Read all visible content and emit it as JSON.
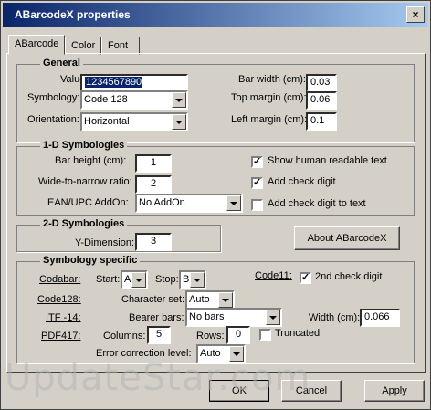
{
  "window": {
    "title": "ABarcodeX properties",
    "close_glyph": "×"
  },
  "tabs": [
    {
      "label": "ABarcode"
    },
    {
      "label": "Color"
    },
    {
      "label": "Font"
    }
  ],
  "general": {
    "title": "General",
    "value_label": "Value:",
    "value": "1234567890",
    "symbology_label": "Symbology:",
    "symbology_value": "Code 128",
    "orientation_label": "Orientation:",
    "orientation_value": "Horizontal",
    "bar_width_label": "Bar width (cm):",
    "bar_width_value": "0.03",
    "top_margin_label": "Top margin (cm):",
    "top_margin_value": "0.06",
    "left_margin_label": "Left margin (cm):",
    "left_margin_value": "0.1"
  },
  "one_d": {
    "title": "1-D Symbologies",
    "bar_height_label": "Bar height (cm):",
    "bar_height_value": "1",
    "wide_narrow_label": "Wide-to-narrow ratio:",
    "wide_narrow_value": "2",
    "ean_label": "EAN/UPC AddOn:",
    "ean_value": "No AddOn",
    "show_human_label": "Show human readable text",
    "add_check_label": "Add check digit",
    "add_check_text_label": "Add check digit to text",
    "check_mark": "✓"
  },
  "two_d": {
    "title": "2-D Symbologies",
    "y_dimension_label": "Y-Dimension:",
    "y_dimension_value": "3"
  },
  "about_button": "About ABarcodeX",
  "specific": {
    "title": "Symbology specific",
    "codabar_label": "Codabar:",
    "start_label": "Start:",
    "start_value": "A",
    "stop_label": "Stop:",
    "stop_value": "B",
    "code11_label": "Code11:",
    "second_check_label": "2nd check digit",
    "code128_label": "Code128:",
    "charset_label": "Character set:",
    "charset_value": "Auto",
    "itf_label": "ITF -14:",
    "bearer_label": "Bearer bars:",
    "bearer_value": "No bars",
    "width_label": "Width (cm):",
    "width_value": "0.066",
    "pdf_label": "PDF417:",
    "columns_label": "Columns:",
    "columns_value": "5",
    "rows_label": "Rows:",
    "rows_value": "0",
    "truncated_label": "Truncated",
    "ecl_label": "Error correction level:",
    "ecl_value": "Auto"
  },
  "buttons": {
    "ok": "OK",
    "cancel": "Cancel",
    "apply": "Apply"
  },
  "watermark": "UpdateStar.com"
}
